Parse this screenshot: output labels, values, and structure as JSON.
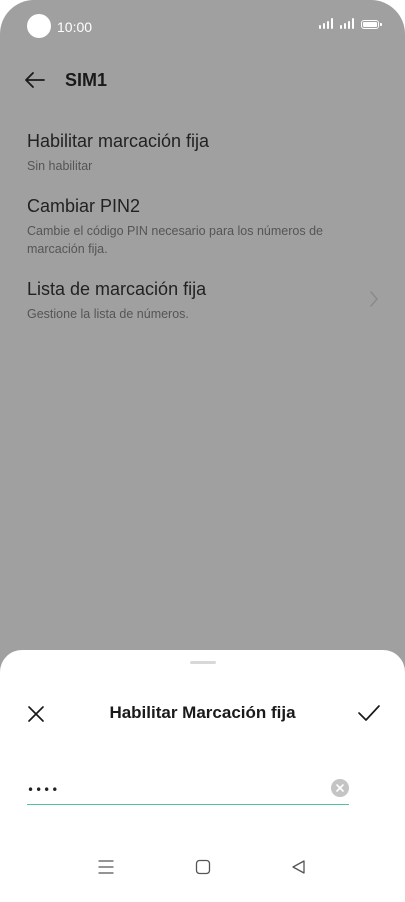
{
  "status_bar": {
    "time": "10:00"
  },
  "app_bar": {
    "title": "SIM1",
    "back_icon": "arrow-left-icon"
  },
  "settings": [
    {
      "title": "Habilitar marcación fija",
      "subtitle": "Sin habilitar"
    },
    {
      "title": "Cambiar PIN2",
      "subtitle": "Cambie el código PIN necesario para los números de marcación fija."
    },
    {
      "title": "Lista de marcación fija",
      "subtitle": "Gestione la lista de números.",
      "has_chevron": true
    }
  ],
  "sheet": {
    "title": "Habilitar Marcación fija",
    "pin_value": "••••",
    "accent_color": "#4fc3a1",
    "close_icon": "close-icon",
    "confirm_icon": "check-icon",
    "clear_icon": "clear-icon"
  },
  "nav_bar": {
    "icons": [
      "menu-icon",
      "home-icon",
      "back-triangle-icon"
    ]
  }
}
